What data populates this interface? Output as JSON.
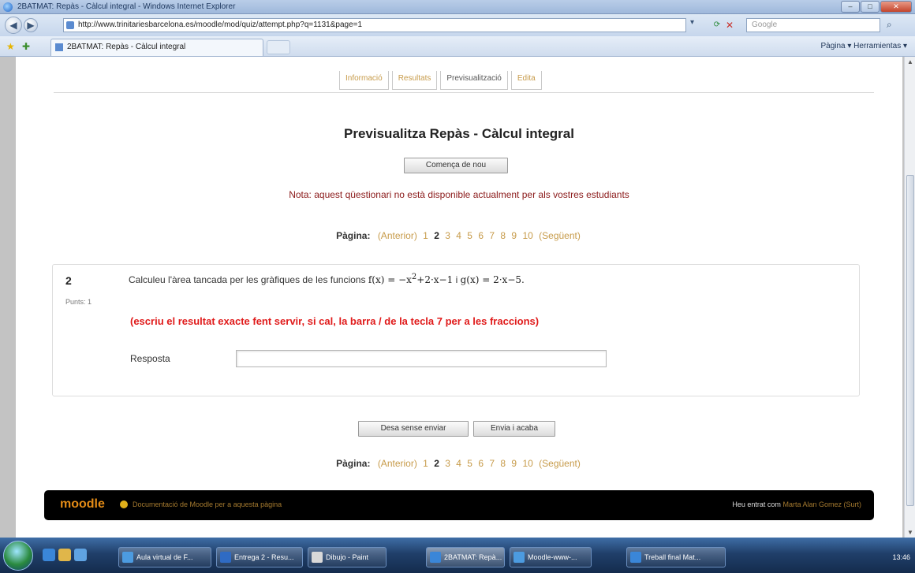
{
  "window": {
    "title": "2BATMAT: Repàs - Càlcul integral - Windows Internet Explorer",
    "min": "–",
    "max": "□",
    "close": "✕"
  },
  "browser": {
    "url": "http://www.trinitariesbarcelona.es/moodle/mod/quiz/attempt.php?q=1131&page=1",
    "search_placeholder": "Google",
    "tab_title": "2BATMAT: Repàs - Càlcul integral",
    "command_bar": "Pàgina ▾   Herramientas ▾"
  },
  "quiz_tabs": [
    {
      "label": "Informació"
    },
    {
      "label": "Resultats"
    },
    {
      "label": "Previsualització"
    },
    {
      "label": "Edita"
    }
  ],
  "heading": "Previsualitza Repàs - Càlcul integral",
  "restart_button": "Comença de nou",
  "note": "Nota: aquest qüestionari no està disponible actualment per als vostres estudiants",
  "pagination": {
    "label": "Pàgina:",
    "prev": "(Anterior)",
    "pages": [
      "1",
      "2",
      "3",
      "4",
      "5",
      "6",
      "7",
      "8",
      "9",
      "10"
    ],
    "current": "2",
    "next": "(Següent)"
  },
  "question": {
    "number": "2",
    "points": "Punts: 1",
    "text": "Calculeu l'àrea tancada per les gràfiques de les funcions",
    "f": "f(x) = −x",
    "f_exp": "2",
    "f_rest": "+2·x−1",
    "conj": "i",
    "g": "g(x) = 2·x−5.",
    "warning": "(escriu el resultat exacte fent servir, si cal, la barra / de la tecla 7 per a les fraccions)",
    "answer_label": "Resposta",
    "answer_value": ""
  },
  "buttons": {
    "save": "Desa sense enviar",
    "submit": "Envia i acaba"
  },
  "footer": {
    "logo": "moodle",
    "doc_link": "Documentació de Moodle per a aquesta pàgina",
    "logged_prefix": "Heu entrat com",
    "user": "Marta Alan Gomez",
    "logout": "(Surt)"
  },
  "taskbar": {
    "items": [
      {
        "label": "Aula virtual de F..."
      },
      {
        "label": "Entrega 2 - Resu..."
      },
      {
        "label": "Dibujo - Paint"
      },
      {
        "label": "2BATMAT: Repà..."
      },
      {
        "label": "Moodle-www-..."
      },
      {
        "label": "Treball final Mat..."
      }
    ],
    "clock": "13:46"
  }
}
